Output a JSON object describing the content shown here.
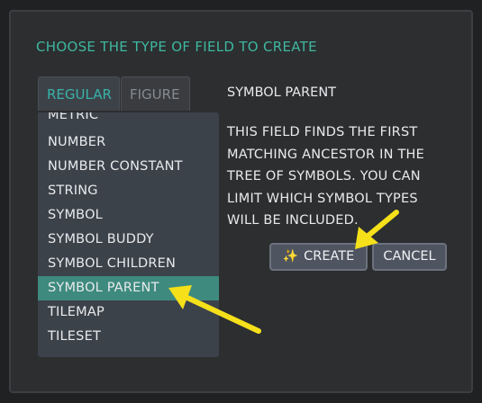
{
  "dialog": {
    "title": "CHOOSE THE TYPE OF FIELD TO CREATE",
    "tabs": [
      {
        "label": "REGULAR",
        "active": true
      },
      {
        "label": "FIGURE",
        "active": false
      }
    ],
    "items": [
      {
        "label": "METRIC"
      },
      {
        "label": "NUMBER"
      },
      {
        "label": "NUMBER CONSTANT"
      },
      {
        "label": "STRING"
      },
      {
        "label": "SYMBOL"
      },
      {
        "label": "SYMBOL BUDDY"
      },
      {
        "label": "SYMBOL CHILDREN"
      },
      {
        "label": "SYMBOL PARENT",
        "selected": true
      },
      {
        "label": "TILEMAP"
      },
      {
        "label": "TILESET"
      }
    ],
    "description": {
      "title": "SYMBOL PARENT",
      "body": "THIS FIELD FINDS THE FIRST MATCHING ANCESTOR IN THE TREE OF SYMBOLS. YOU CAN LIMIT WHICH SYMBOL TYPES WILL BE INCLUDED."
    },
    "buttons": {
      "create_icon": "sparkles-icon",
      "create_label": "CREATE",
      "cancel_label": "CANCEL"
    }
  },
  "colors": {
    "accent": "#3fb7a0",
    "selected_row": "#3e8a7f",
    "annotation_arrow": "#f5e01a"
  }
}
